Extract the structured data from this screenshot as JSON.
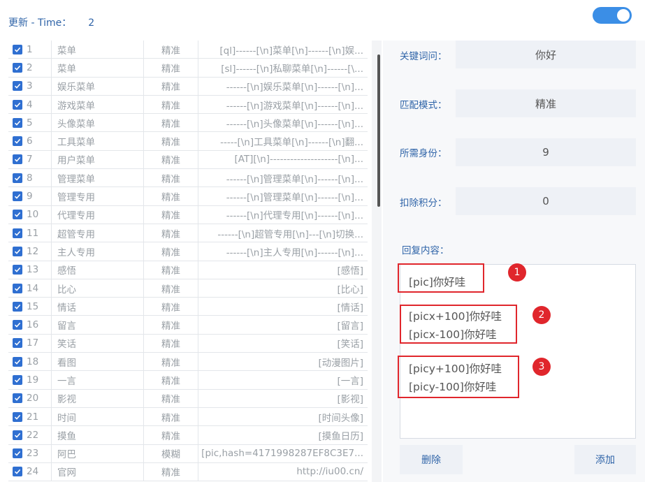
{
  "header": {
    "label": "更新 - Time：",
    "time_value": "2"
  },
  "rules": [
    {
      "no": "1",
      "name": "菜单",
      "mode": "精准",
      "reply": "[ql]------[\\n]菜单[\\n]------[\\n]娱..."
    },
    {
      "no": "2",
      "name": "菜单",
      "mode": "精准",
      "reply": "[sl]------[\\n]私聊菜单[\\n]------[\\..."
    },
    {
      "no": "3",
      "name": "娱乐菜单",
      "mode": "精准",
      "reply": "------[\\n]娱乐菜单[\\n]------[\\n]..."
    },
    {
      "no": "4",
      "name": "游戏菜单",
      "mode": "精准",
      "reply": "------[\\n]游戏菜单[\\n]------[\\n]..."
    },
    {
      "no": "5",
      "name": "头像菜单",
      "mode": "精准",
      "reply": "------[\\n]头像菜单[\\n]------[\\n]..."
    },
    {
      "no": "6",
      "name": "工具菜单",
      "mode": "精准",
      "reply": "-----[\\n]工具菜单[\\n]------[\\n]翻..."
    },
    {
      "no": "7",
      "name": "用户菜单",
      "mode": "精准",
      "reply": "[AT][\\n]--------------------[\\n]..."
    },
    {
      "no": "8",
      "name": "管理菜单",
      "mode": "精准",
      "reply": "------[\\n]管理菜单[\\n]------[\\n]..."
    },
    {
      "no": "9",
      "name": "管理专用",
      "mode": "精准",
      "reply": "------[\\n]管理菜单[\\n]------[\\n]..."
    },
    {
      "no": "10",
      "name": "代理专用",
      "mode": "精准",
      "reply": "------[\\n]代理专用[\\n]------[\\n]..."
    },
    {
      "no": "11",
      "name": "超管专用",
      "mode": "精准",
      "reply": "------[\\n]超管专用[\\n]---[\\n]切换..."
    },
    {
      "no": "12",
      "name": "主人专用",
      "mode": "精准",
      "reply": "------[\\n]主人专用[\\n]------[\\n]..."
    },
    {
      "no": "13",
      "name": "感悟",
      "mode": "精准",
      "reply": "[感悟]"
    },
    {
      "no": "14",
      "name": "比心",
      "mode": "精准",
      "reply": "[比心]"
    },
    {
      "no": "15",
      "name": "情话",
      "mode": "精准",
      "reply": "[情话]"
    },
    {
      "no": "16",
      "name": "留言",
      "mode": "精准",
      "reply": "[留言]"
    },
    {
      "no": "17",
      "name": "笑话",
      "mode": "精准",
      "reply": "[笑话]"
    },
    {
      "no": "18",
      "name": "看图",
      "mode": "精准",
      "reply": "[动漫图片]"
    },
    {
      "no": "19",
      "name": "一言",
      "mode": "精准",
      "reply": "[一言]"
    },
    {
      "no": "20",
      "name": "影视",
      "mode": "精准",
      "reply": "[影视]"
    },
    {
      "no": "21",
      "name": "时间",
      "mode": "精准",
      "reply": "[时间头像]"
    },
    {
      "no": "22",
      "name": "摸鱼",
      "mode": "精准",
      "reply": "[摸鱼日历]"
    },
    {
      "no": "23",
      "name": "阿巴",
      "mode": "模糊",
      "reply": "[pic,hash=4171998287EF8C3E7..."
    },
    {
      "no": "24",
      "name": "官网",
      "mode": "精准",
      "reply": "http://iu00.cn/"
    }
  ],
  "form": {
    "keyword_label": "关键词问：",
    "keyword_value": "你好",
    "match_label": "匹配模式：",
    "match_value": "精准",
    "role_label": "所需身份：",
    "role_value": "9",
    "points_label": "扣除积分：",
    "points_value": "0",
    "reply_label": "回复内容：",
    "reply_lines": [
      "[pic]你好哇",
      "[picx+100]你好哇",
      "[picx-100]你好哇",
      "[picy+100]你好哇",
      "[picy-100]你好哇"
    ],
    "badges": [
      "1",
      "2",
      "3"
    ]
  },
  "buttons": {
    "delete": "删除",
    "add": "添加"
  },
  "colors": {
    "accent": "#2f64a8",
    "checkbox": "#2f6fd1",
    "toggle": "#3b8ee6",
    "annotation": "#e0262c"
  }
}
